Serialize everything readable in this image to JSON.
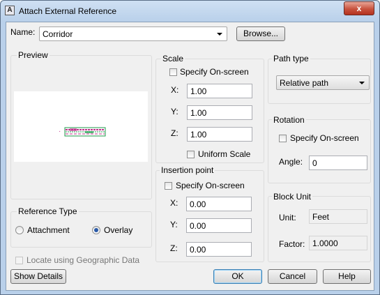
{
  "window": {
    "title": "Attach External Reference",
    "close_glyph": "x"
  },
  "name_field": {
    "label": "Name:",
    "value": "Corridor",
    "browse_label": "Browse..."
  },
  "preview": {
    "label": "Preview",
    "dot": "·"
  },
  "reference_type": {
    "label": "Reference Type",
    "attachment": "Attachment",
    "overlay": "Overlay",
    "selected": "Overlay"
  },
  "geo": {
    "label": "Locate using Geographic Data"
  },
  "scale": {
    "label": "Scale",
    "specify": "Specify On-screen",
    "x_label": "X:",
    "x": "1.00",
    "y_label": "Y:",
    "y": "1.00",
    "z_label": "Z:",
    "z": "1.00",
    "uniform": "Uniform Scale"
  },
  "insertion": {
    "label": "Insertion point",
    "specify": "Specify On-screen",
    "x_label": "X:",
    "x": "0.00",
    "y_label": "Y:",
    "y": "0.00",
    "z_label": "Z:",
    "z": "0.00"
  },
  "path_type": {
    "label": "Path type",
    "value": "Relative path"
  },
  "rotation": {
    "label": "Rotation",
    "specify": "Specify On-screen",
    "angle_label": "Angle:",
    "angle": "0"
  },
  "block_unit": {
    "label": "Block Unit",
    "unit_label": "Unit:",
    "unit": "Feet",
    "factor_label": "Factor:",
    "factor": "1.0000"
  },
  "buttons": {
    "show_details": "Show Details",
    "ok": "OK",
    "cancel": "Cancel",
    "help": "Help"
  },
  "colors": {
    "accent": "#2a5aa8",
    "preview_magenta": "#c0308c",
    "preview_green": "#1d9a4a"
  }
}
